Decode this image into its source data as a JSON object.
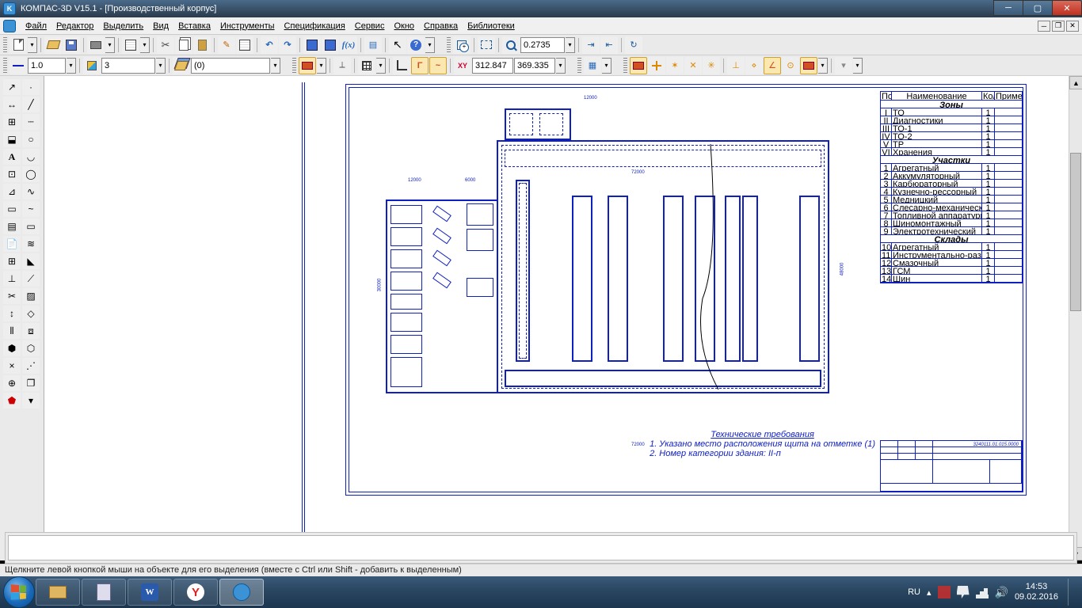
{
  "title": {
    "app": "КОМПАС-3D V15.1",
    "doc": "[Производственный корпус]"
  },
  "menu": [
    "Файл",
    "Редактор",
    "Выделить",
    "Вид",
    "Вставка",
    "Инструменты",
    "Спецификация",
    "Сервис",
    "Окно",
    "Справка",
    "Библиотеки"
  ],
  "toolbar1": {
    "zoom_value": "0.2735"
  },
  "toolbar2": {
    "style_val": "1.0",
    "layer_val": "3",
    "state_val": "(0)",
    "coord_x": "312.847",
    "coord_y": "369.335"
  },
  "spec_table": {
    "headers": [
      "Поз",
      "Наименование",
      "Кол.",
      "Примечание"
    ],
    "sections": [
      "Зоны",
      "Участки",
      "Склады"
    ],
    "zones": [
      [
        "I",
        "ТО",
        "1",
        ""
      ],
      [
        "II",
        "Диагностики",
        "1",
        ""
      ],
      [
        "III",
        "ТО-1",
        "1",
        ""
      ],
      [
        "IV",
        "ТО-2",
        "1",
        ""
      ],
      [
        "V",
        "ТР",
        "1",
        ""
      ],
      [
        "VI",
        "Хранения",
        "1",
        ""
      ]
    ],
    "areas": [
      [
        "1",
        "Агрегатный",
        "1",
        ""
      ],
      [
        "2",
        "Аккумуляторный",
        "1",
        ""
      ],
      [
        "3",
        "Карбюраторный",
        "1",
        ""
      ],
      [
        "4",
        "Кузнечно-рессорный",
        "1",
        ""
      ],
      [
        "5",
        "Медницкий",
        "1",
        ""
      ],
      [
        "6",
        "Слесарно-механический",
        "1",
        ""
      ],
      [
        "7",
        "Топливной аппаратуры",
        "1",
        ""
      ],
      [
        "8",
        "Шиномонтажный",
        "1",
        ""
      ],
      [
        "9",
        "Электротехнический",
        "1",
        ""
      ]
    ],
    "stores": [
      [
        "10",
        "Агрегатный",
        "1",
        ""
      ],
      [
        "11",
        "Инструментально-раздаточная кладовая",
        "1",
        ""
      ],
      [
        "12",
        "Смазочный",
        "1",
        ""
      ],
      [
        "13",
        "ГСМ",
        "1",
        ""
      ],
      [
        "14",
        "Шин",
        "1",
        ""
      ]
    ]
  },
  "notes": {
    "title": "Технические требования",
    "n1": "1. Указано место расположения щита на отметке (1)",
    "n2": "2. Номер категории здания: II-п"
  },
  "stamp_code": "3240111.01.015.0000",
  "status": "Щелкните левой кнопкой мыши на объекте для его выделения (вместе с Ctrl или Shift - добавить к выделенным)",
  "tray": {
    "lang": "RU",
    "time": "14:53",
    "date": "09.02.2016"
  }
}
